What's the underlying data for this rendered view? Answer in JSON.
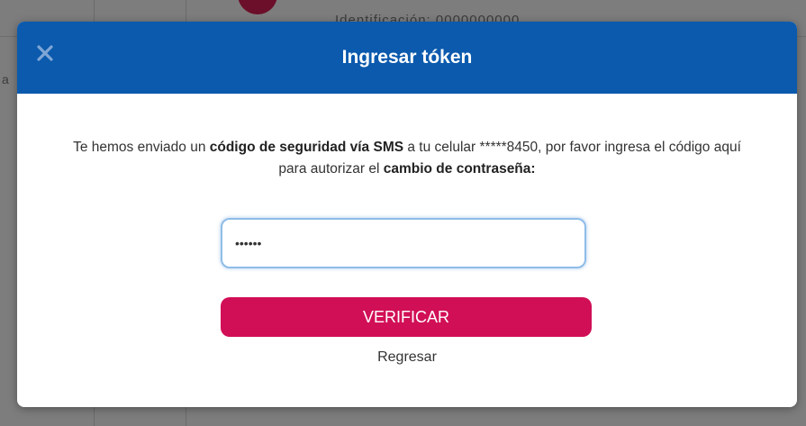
{
  "background": {
    "partial_text": "Identificación: 0000000000",
    "edge_char": "a"
  },
  "modal": {
    "title": "Ingresar tóken",
    "close_icon": "close-icon",
    "message": {
      "part1": "Te hemos enviado un ",
      "bold1": "código de seguridad vía SMS",
      "part2": " a tu celular *****8450, por favor ingresa el código aquí para autorizar el ",
      "bold2": "cambio de contraseña:"
    },
    "token_input": {
      "value": "••••••",
      "placeholder": ""
    },
    "verify_button": "VERIFICAR",
    "back_link": "Regresar"
  },
  "colors": {
    "header": "#0b5aad",
    "primary_button": "#d10f56",
    "input_focus": "#8fbde8"
  }
}
